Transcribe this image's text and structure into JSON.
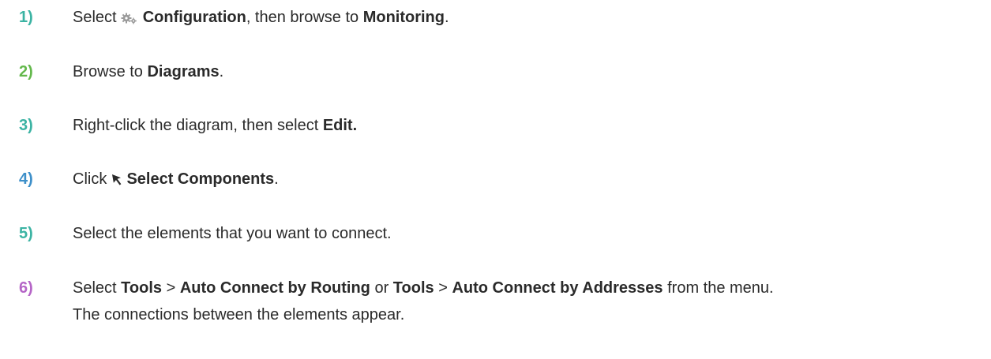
{
  "colors": {
    "step1": "#3bb3a3",
    "step2": "#63b84b",
    "step3": "#3bb3a3",
    "step4": "#3d8fc9",
    "step5": "#3bb3a3",
    "step6": "#b565c7"
  },
  "icons": {
    "configuration": "gear-icon",
    "select_components": "cursor-arrow-icon"
  },
  "steps": [
    {
      "number": "1)",
      "select": "Select ",
      "configuration": "Configuration",
      "then_browse": ", then browse to ",
      "monitoring": "Monitoring",
      "period": "."
    },
    {
      "number": "2)",
      "browse": "Browse to ",
      "diagrams": "Diagrams",
      "period": "."
    },
    {
      "number": "3)",
      "text": "Right-click the diagram, then select ",
      "edit": "Edit."
    },
    {
      "number": "4)",
      "click": "Click ",
      "select_components": "Select Components",
      "period": "."
    },
    {
      "number": "5)",
      "text": "Select the elements that you want to connect."
    },
    {
      "number": "6)",
      "select": "Select ",
      "tools1": "Tools",
      "gt1": " > ",
      "auto_routing": "Auto Connect by Routing",
      "or": " or ",
      "tools2": "Tools",
      "gt2": " > ",
      "auto_addresses": "Auto Connect by Addresses",
      "from_menu": " from the menu.",
      "result": "The connections between the elements appear."
    }
  ]
}
